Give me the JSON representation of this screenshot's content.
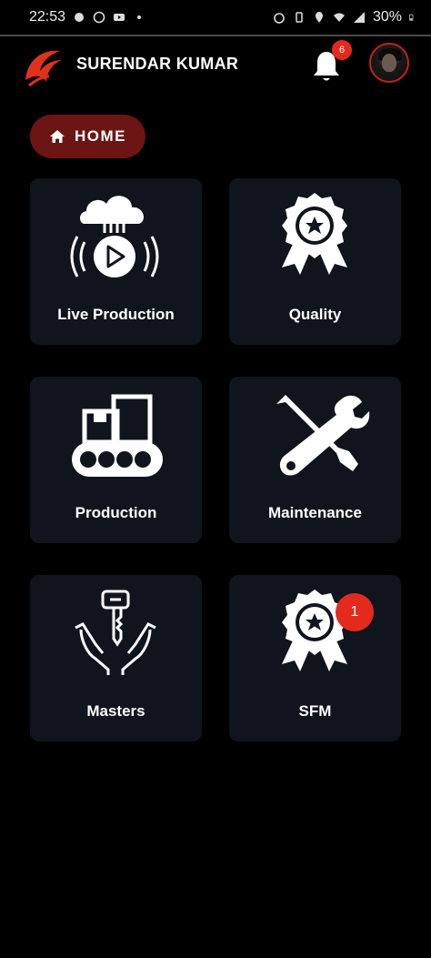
{
  "status_bar": {
    "time": "22:53",
    "battery": "30%"
  },
  "header": {
    "user_name": "SURENDAR KUMAR",
    "notification_count": "6"
  },
  "home_button": {
    "label": "HOME"
  },
  "tiles": [
    {
      "label": "Live Production",
      "icon": "cloud-play-icon"
    },
    {
      "label": "Quality",
      "icon": "award-badge-icon"
    },
    {
      "label": "Production",
      "icon": "conveyor-icon"
    },
    {
      "label": "Maintenance",
      "icon": "wrench-screwdriver-icon"
    },
    {
      "label": "Masters",
      "icon": "hands-key-icon"
    },
    {
      "label": "SFM",
      "icon": "award-badge-icon",
      "badge": "1"
    }
  ],
  "colors": {
    "accent": "#e42a1d",
    "home_pill": "#6d1414",
    "tile_bg": "#10141c"
  }
}
